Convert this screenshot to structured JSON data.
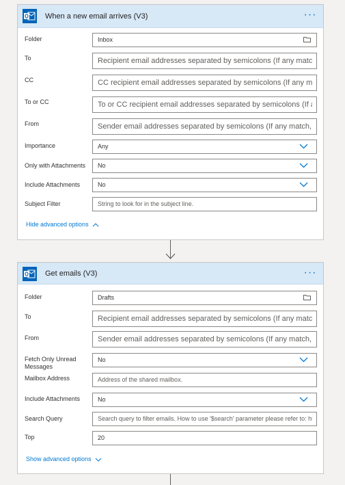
{
  "trigger": {
    "title": "When a new email arrives (V3)",
    "icon": "outlook-icon",
    "more_label": "···",
    "fields": [
      {
        "label": "Folder",
        "value": "Inbox",
        "type": "folder-picker"
      },
      {
        "label": "To",
        "placeholder": "Recipient email addresses separated by semicolons (If any match, the"
      },
      {
        "label": "CC",
        "placeholder": "CC recipient email addresses separated by semicolons (If any match,"
      },
      {
        "label": "To or CC",
        "placeholder": "To or CC recipient email addresses separated by semicolons (If any m"
      },
      {
        "label": "From",
        "placeholder": "Sender email addresses separated by semicolons (If any match, the tr"
      },
      {
        "label": "Importance",
        "value": "Any",
        "type": "dropdown"
      },
      {
        "label": "Only with Attachments",
        "value": "No",
        "type": "dropdown"
      },
      {
        "label": "Include Attachments",
        "value": "No",
        "type": "dropdown"
      },
      {
        "label": "Subject Filter",
        "placeholder": "String to look for in the subject line."
      }
    ],
    "advanced_link": "Hide advanced options"
  },
  "action": {
    "title": "Get emails (V3)",
    "icon": "outlook-icon",
    "more_label": "···",
    "fields": [
      {
        "label": "Folder",
        "value": "Drafts",
        "type": "folder-picker"
      },
      {
        "label": "To",
        "placeholder": "Recipient email addresses separated by semicolons (If any match, the"
      },
      {
        "label": "From",
        "placeholder": "Sender email addresses separated by semicolons (If any match, the tr"
      },
      {
        "label": "Fetch Only Unread Messages",
        "value": "No",
        "type": "dropdown"
      },
      {
        "label": "Mailbox Address",
        "placeholder": "Address of the shared mailbox."
      },
      {
        "label": "Include Attachments",
        "value": "No",
        "type": "dropdown"
      },
      {
        "label": "Search Query",
        "placeholder": "Search query to filter emails. How to use '$search' parameter please refer to: ht"
      },
      {
        "label": "Top",
        "value": "20"
      }
    ],
    "advanced_link": "Show advanced options"
  },
  "colors": {
    "header_bg": "#d7e8f7",
    "accent": "#0078d4",
    "outlook_blue": "#0364b8"
  }
}
